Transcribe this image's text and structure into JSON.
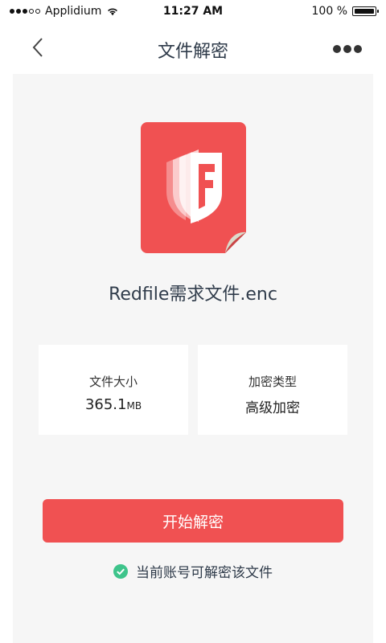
{
  "status_bar": {
    "carrier": "Applidium",
    "time": "11:27 AM",
    "battery": "100 %",
    "signal_bars_filled": 3,
    "signal_bars_total": 5
  },
  "nav": {
    "title": "文件解密",
    "back_icon": "chevron-left-icon",
    "more_icon": "more-horizontal-icon"
  },
  "file": {
    "name": "Redfile需求文件.enc",
    "icon": "redfile-document-icon"
  },
  "info": {
    "size_label": "文件大小",
    "size_value": "365.1",
    "size_unit": "MB",
    "type_label": "加密类型",
    "type_value": "高级加密"
  },
  "action": {
    "decrypt_label": "开始解密"
  },
  "notice": {
    "text": "当前账号可解密该文件",
    "icon": "check-circle-icon"
  },
  "colors": {
    "accent": "#f05152",
    "check_green": "#3ec48b",
    "background_panel": "#f6f6f6"
  }
}
